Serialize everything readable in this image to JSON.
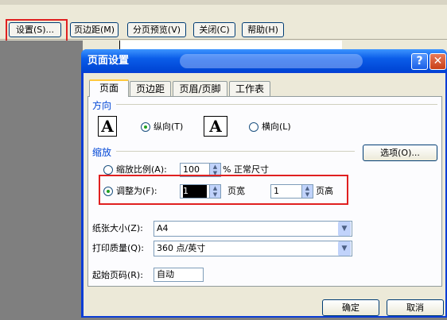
{
  "toolbar": {
    "buttons": [
      "设置(S)...",
      "页边距(M)",
      "分页预览(V)",
      "关闭(C)",
      "帮助(H)"
    ]
  },
  "dialog": {
    "title": "页面设置",
    "tabs": [
      "页面",
      "页边距",
      "页眉/页脚",
      "工作表"
    ],
    "orientation": {
      "group_label": "方向",
      "icon_letter": "A",
      "portrait_label": "纵向(T)",
      "landscape_label": "横向(L)",
      "selected": "portrait"
    },
    "scaling": {
      "group_label": "缩放",
      "options_button": "选项(O)...",
      "adjust_label": "缩放比例(A):",
      "adjust_value": "100",
      "adjust_suffix": "% 正常尺寸",
      "fit_label": "调整为(F):",
      "fit_pages_wide": "1",
      "pages_wide_label": "页宽",
      "fit_pages_tall": "1",
      "pages_tall_label": "页高",
      "selected": "fit"
    },
    "paper_size": {
      "label": "纸张大小(Z):",
      "value": "A4"
    },
    "print_quality": {
      "label": "打印质量(Q):",
      "value": "360 点/英寸"
    },
    "first_page": {
      "label": "起始页码(R):",
      "value": "自动"
    },
    "buttons": {
      "ok": "确定",
      "cancel": "取消"
    },
    "help_glyph": "?",
    "close_glyph": "✕"
  },
  "colors": {
    "highlight": "#e02020",
    "xp_blue": "#0a3dd6",
    "group_label": "#0046d5"
  }
}
